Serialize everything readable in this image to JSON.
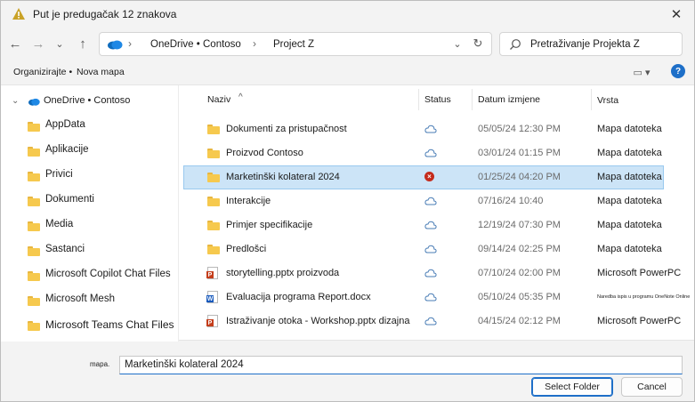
{
  "window": {
    "title": "Put je predugačak 12 znakova"
  },
  "address": {
    "crumbs": [
      "OneDrive • Contoso",
      "Project Z"
    ]
  },
  "search": {
    "placeholder": "Pretraživanje Projekta Z"
  },
  "toolbar": {
    "organize": "Organizirajte •",
    "new_folder": "Nova mapa"
  },
  "sidebar": {
    "root": "OneDrive • Contoso",
    "items": [
      {
        "label": "AppData"
      },
      {
        "label": "Aplikacije"
      },
      {
        "label": "Privici"
      },
      {
        "label": "Dokumenti"
      },
      {
        "label": "Media"
      },
      {
        "label": "Sastanci"
      },
      {
        "label": "Microsoft Copilot Chat Files"
      },
      {
        "label": "Microsoft Mesh"
      },
      {
        "label": "Microsoft Teams Chat Files"
      }
    ]
  },
  "columns": {
    "name": "Naziv",
    "status": "Status",
    "date": "Datum izmjene",
    "type": "Vrsta"
  },
  "files": [
    {
      "name": "Dokumenti za pristupačnost",
      "date": "05/05/24 12:30 PM",
      "type": "Mapa datoteka",
      "kind": "folder",
      "status": "cloud"
    },
    {
      "name": "Proizvod Contoso",
      "date": "03/01/24 01:15 PM",
      "type": "Mapa datoteka",
      "kind": "folder",
      "status": "cloud"
    },
    {
      "name": "Marketinški kolateral 2024",
      "date": "01/25/24 04:20 PM",
      "type": "Mapa datoteka",
      "kind": "folder",
      "status": "error",
      "selected": true
    },
    {
      "name": "Interakcije",
      "date": "07/16/24 10:40",
      "type": "Mapa datoteka",
      "kind": "folder",
      "status": "cloud"
    },
    {
      "name": "Primjer specifikacije",
      "date": "12/19/24 07:30 PM",
      "type": "Mapa datoteka",
      "kind": "folder",
      "status": "cloud"
    },
    {
      "name": "Predlošci",
      "date": "09/14/24 02:25 PM",
      "type": "Mapa datoteka",
      "kind": "folder",
      "status": "cloud"
    },
    {
      "name": "storytelling.pptx proizvoda",
      "date": "07/10/24 02:00 PM",
      "type": "Microsoft PowerPC",
      "kind": "pptx",
      "status": "cloud"
    },
    {
      "name": "Evaluacija programa Report.docx",
      "date": "05/10/24 05:35 PM",
      "type": "Naredba ispis u programu OneNote Online",
      "kind": "docx",
      "status": "cloud",
      "tiny_type": true
    },
    {
      "name": "Istraživanje otoka - Workshop.pptx dizajna",
      "date": "04/15/24 02:12 PM",
      "type": "Microsoft PowerPC",
      "kind": "pptx",
      "status": "cloud"
    }
  ],
  "footer": {
    "filename_label": "mapa.",
    "filename_value": "Marketinški kolateral 2024",
    "select_label": "Select Folder",
    "cancel_label": "Cancel"
  },
  "colors": {
    "accent": "#1e6fc8",
    "selection": "#cce4f7",
    "folder": "#f6c94e",
    "error": "#c42b1c"
  }
}
